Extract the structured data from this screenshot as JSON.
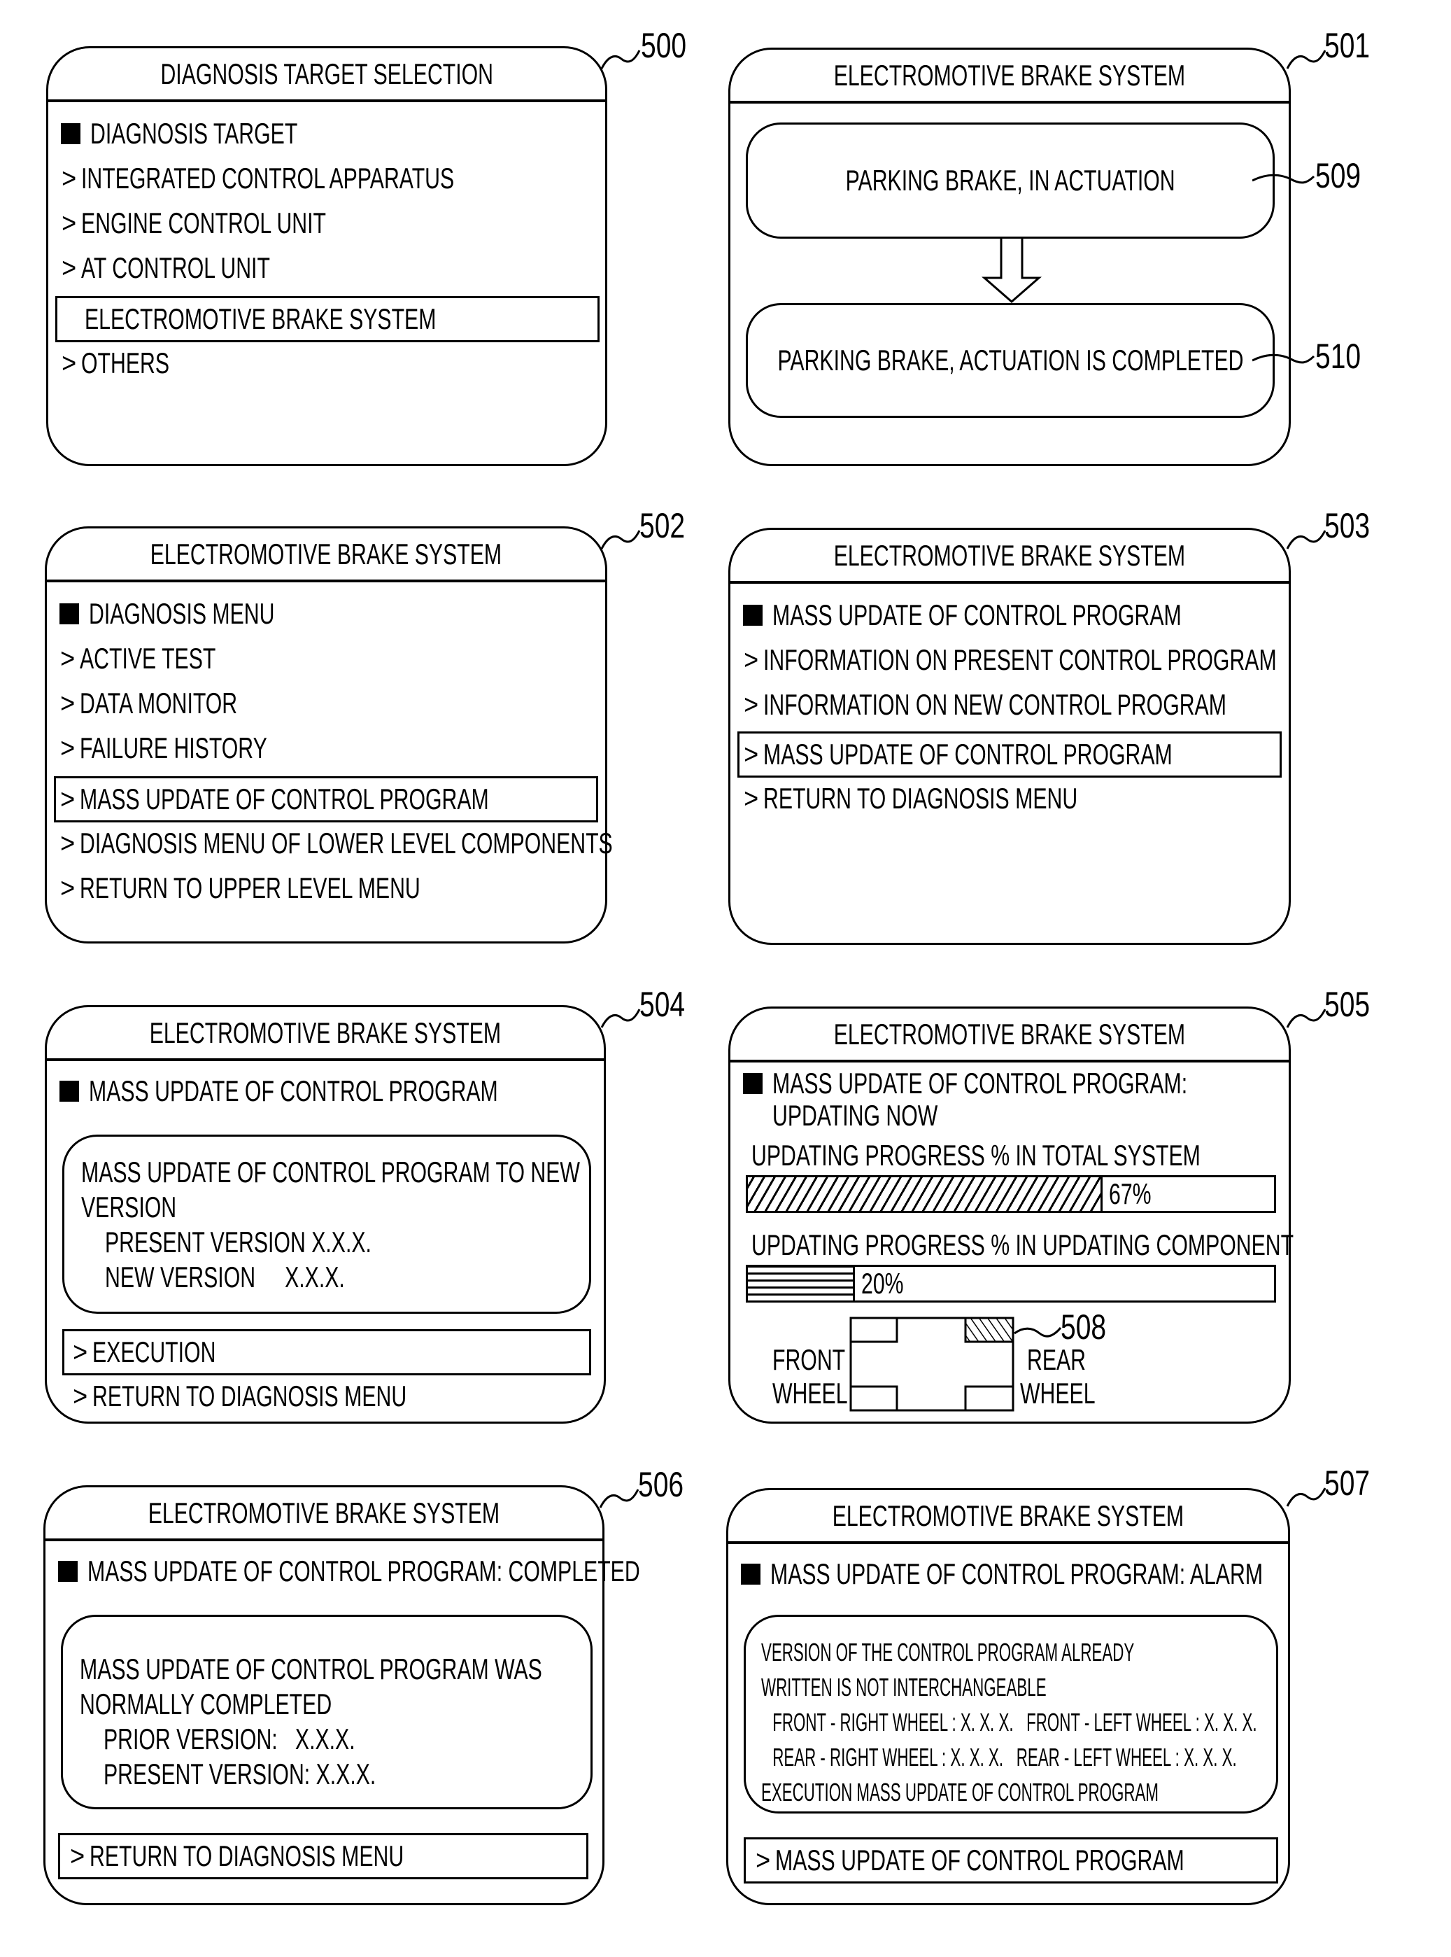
{
  "panels": {
    "p500": {
      "ref": "500",
      "title": "DIAGNOSIS TARGET SELECTION",
      "heading": "DIAGNOSIS TARGET",
      "items": [
        {
          "label": "INTEGRATED CONTROL APPARATUS",
          "prefix": ">"
        },
        {
          "label": "ENGINE CONTROL UNIT",
          "prefix": ">"
        },
        {
          "label": "AT CONTROL UNIT",
          "prefix": ">"
        },
        {
          "label": "ELECTROMOTIVE BRAKE SYSTEM",
          "prefix": "",
          "selected": true
        },
        {
          "label": "OTHERS",
          "prefix": ">"
        }
      ]
    },
    "p501": {
      "ref": "501",
      "title": "ELECTROMOTIVE BRAKE SYSTEM",
      "state1": {
        "ref": "509",
        "label": "PARKING BRAKE, IN ACTUATION"
      },
      "state2": {
        "ref": "510",
        "label": "PARKING BRAKE, ACTUATION IS COMPLETED"
      }
    },
    "p502": {
      "ref": "502",
      "title": "ELECTROMOTIVE BRAKE SYSTEM",
      "heading": "DIAGNOSIS MENU",
      "items": [
        {
          "label": "ACTIVE TEST",
          "prefix": ">"
        },
        {
          "label": "DATA MONITOR",
          "prefix": ">"
        },
        {
          "label": "FAILURE HISTORY",
          "prefix": ">"
        },
        {
          "label": "MASS UPDATE OF CONTROL PROGRAM",
          "prefix": ">",
          "selected": true
        },
        {
          "label": "DIAGNOSIS MENU OF LOWER LEVEL COMPONENTS",
          "prefix": ">"
        },
        {
          "label": "RETURN TO UPPER LEVEL MENU",
          "prefix": ">"
        }
      ]
    },
    "p503": {
      "ref": "503",
      "title": "ELECTROMOTIVE BRAKE SYSTEM",
      "heading": "MASS UPDATE OF CONTROL PROGRAM",
      "items": [
        {
          "label": "INFORMATION ON PRESENT CONTROL PROGRAM",
          "prefix": ">"
        },
        {
          "label": "INFORMATION ON NEW CONTROL PROGRAM",
          "prefix": ">"
        },
        {
          "label": "MASS UPDATE OF CONTROL PROGRAM",
          "prefix": ">",
          "selected": true
        },
        {
          "label": "RETURN TO DIAGNOSIS MENU",
          "prefix": ">"
        }
      ]
    },
    "p504": {
      "ref": "504",
      "title": "ELECTROMOTIVE BRAKE SYSTEM",
      "heading": "MASS UPDATE OF CONTROL PROGRAM",
      "message": [
        "MASS UPDATE OF CONTROL PROGRAM TO NEW",
        "VERSION"
      ],
      "present_version_label": "PRESENT VERSION",
      "present_version": "X.X.X.",
      "new_version_label": "NEW VERSION",
      "new_version": "X.X.X.",
      "execute_label": "EXECUTION",
      "return_label": "RETURN TO DIAGNOSIS MENU",
      "prefix": ">"
    },
    "p505": {
      "ref": "505",
      "title": "ELECTROMOTIVE BRAKE SYSTEM",
      "heading": [
        "MASS UPDATE OF CONTROL PROGRAM:",
        "UPDATING NOW"
      ],
      "total_label": "UPDATING PROGRESS % IN TOTAL SYSTEM",
      "total_progress": 67,
      "total_progress_text": "67%",
      "component_label": "UPDATING PROGRESS % IN UPDATING COMPONENT",
      "component_progress": 20,
      "component_progress_text": "20%",
      "front_label": [
        "FRONT",
        "WHEEL"
      ],
      "rear_label": [
        "REAR",
        "WHEEL"
      ],
      "updating_wheel_ref": "508",
      "updating_wheel": "rear-right"
    },
    "p506": {
      "ref": "506",
      "title": "ELECTROMOTIVE BRAKE SYSTEM",
      "heading": "MASS UPDATE OF CONTROL PROGRAM: COMPLETED",
      "message": [
        "MASS UPDATE OF CONTROL PROGRAM WAS",
        "NORMALLY COMPLETED"
      ],
      "prior_version_label": "PRIOR VERSION:",
      "prior_version": "X.X.X.",
      "present_version_label": "PRESENT VERSION:",
      "present_version": "X.X.X.",
      "return_label": "RETURN TO DIAGNOSIS MENU",
      "prefix": ">"
    },
    "p507": {
      "ref": "507",
      "title": "ELECTROMOTIVE BRAKE SYSTEM",
      "heading": "MASS UPDATE OF CONTROL PROGRAM: ALARM",
      "message": [
        "VERSION OF THE CONTROL PROGRAM ALREADY",
        "WRITTEN IS NOT INTERCHANGEABLE",
        " FRONT - RIGHT WHEEL : X. X. X.   FRONT - LEFT WHEEL : X. X. X.",
        " REAR - RIGHT WHEEL : X. X. X.   REAR - LEFT WHEEL : X. X. X.",
        "EXECUTION MASS UPDATE OF CONTROL PROGRAM"
      ],
      "action_label": "MASS UPDATE OF CONTROL PROGRAM",
      "prefix": ">"
    }
  }
}
